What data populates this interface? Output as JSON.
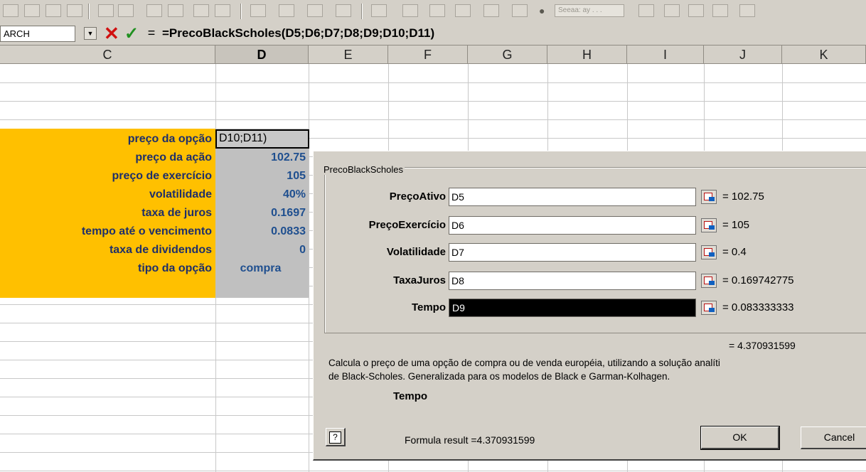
{
  "formula_bar": {
    "name_box": "ARCH",
    "formula": "=PrecoBlackScholes(D5;D6;D7;D8;D9;D10;D11)",
    "fx_symbol": "="
  },
  "toolbar": {
    "font_box": "Seeaa: ay . . ."
  },
  "columns": [
    {
      "label": "C"
    },
    {
      "label": "D"
    },
    {
      "label": "E"
    },
    {
      "label": "F"
    },
    {
      "label": "G"
    },
    {
      "label": "H"
    },
    {
      "label": "I"
    },
    {
      "label": "J"
    },
    {
      "label": "K"
    }
  ],
  "sheet": {
    "labels": [
      "preço da opção",
      "preço da ação",
      "preço de exercício",
      "volatilidade",
      "taxa de juros",
      "tempo até o vencimento",
      "taxa de dividendos",
      "tipo da opção"
    ],
    "active_cell_text": "D10;D11)",
    "values": [
      "102.75",
      "105",
      "40%",
      "0.1697",
      "0.0833",
      "0",
      "compra"
    ]
  },
  "dialog": {
    "group_title": "PrecoBlackScholes",
    "args": [
      {
        "label": "PreçoAtivo",
        "input": "D5",
        "value": "= 102.75"
      },
      {
        "label": "PreçoExercício",
        "input": "D6",
        "value": "= 105"
      },
      {
        "label": "Volatilidade",
        "input": "D7",
        "value": "= 0.4"
      },
      {
        "label": "TaxaJuros",
        "input": "D8",
        "value": "= 0.169742775"
      },
      {
        "label": "Tempo",
        "input": "D9",
        "value": "= 0.083333333"
      }
    ],
    "result": "= 4.370931599",
    "description_line1": "Calcula o preço de uma opção de compra ou de venda européia, utilizando a solução analíti",
    "description_line2": "de Black-Scholes. Generalizada para os modelos de Black e Garman-Kolhagen.",
    "arg_help": "Tempo",
    "help_label": "?",
    "formula_result": "Formula result =4.370931599",
    "ok_label": "OK",
    "cancel_label": "Cancel"
  }
}
